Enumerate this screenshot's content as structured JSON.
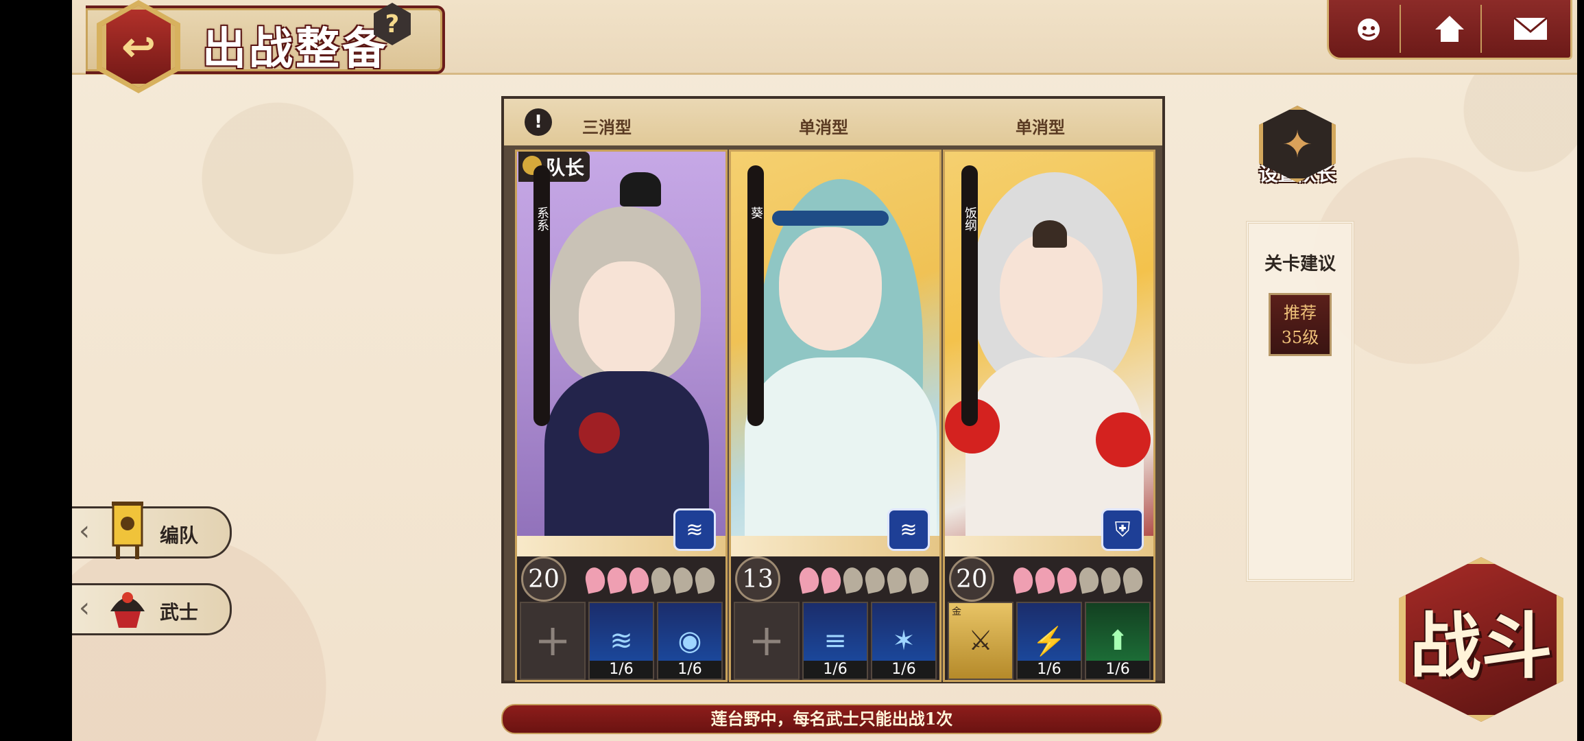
{
  "header": {
    "title": "出战整备",
    "help_label": "?",
    "back_icon": "↩",
    "top_right": [
      "face-icon",
      "home-icon",
      "mail-icon"
    ]
  },
  "cards": [
    {
      "type": "三消型",
      "captain_tag": "队长",
      "name": "系系",
      "level": "20",
      "petals_on": 3,
      "petals_total": 6,
      "skills": [
        {
          "kind": "empty",
          "symbol": "+",
          "count": ""
        },
        {
          "kind": "blue",
          "symbol": "≋",
          "count": "1/6"
        },
        {
          "kind": "blue",
          "symbol": "◉",
          "count": "1/6"
        }
      ]
    },
    {
      "type": "单消型",
      "name": "葵",
      "level": "13",
      "petals_on": 2,
      "petals_total": 6,
      "skills": [
        {
          "kind": "empty",
          "symbol": "+",
          "count": ""
        },
        {
          "kind": "blue",
          "symbol": "≡",
          "count": "1/6"
        },
        {
          "kind": "blue",
          "symbol": "✶",
          "count": "1/6"
        }
      ]
    },
    {
      "type": "单消型",
      "name": "饭纲",
      "level": "20",
      "petals_on": 3,
      "petals_total": 6,
      "skills": [
        {
          "kind": "gold",
          "symbol": "⚔",
          "count": "",
          "tag": "金"
        },
        {
          "kind": "blue",
          "symbol": "⚡",
          "count": "1/6"
        },
        {
          "kind": "green",
          "symbol": "⬆",
          "count": "1/6"
        }
      ]
    }
  ],
  "sidebar": {
    "set_captain": "设置队长",
    "advice_head": "关卡建议",
    "recommend": "推荐",
    "recommend_level": "35级"
  },
  "left_menu": {
    "formation": "编队",
    "samurai": "武士"
  },
  "battle_label": "战斗",
  "rule_text": "莲台野中，每名武士只能出战1次"
}
